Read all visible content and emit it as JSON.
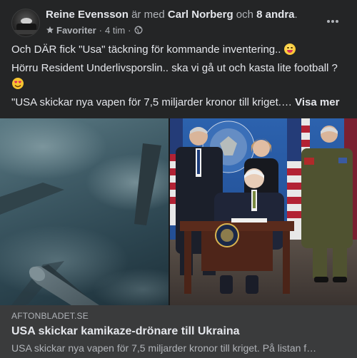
{
  "post": {
    "author": "Reine Evensson",
    "connector": "är med",
    "tagged_person": "Carl Norberg",
    "and": "och",
    "others": "8 andra",
    "period": ".",
    "audience": "Favoriter",
    "dot": "·",
    "time": "4 tim",
    "line1": "Och DÄR fick \"Usa\" täckning för kommande inventering..",
    "line2": "Hörru Resident Underlivsporslin.. ska vi gå ut och kasta lite football ?",
    "line3": "\"USA skickar nya vapen för 7,5 miljarder kronor till kriget.…",
    "see_more": "Visa mer",
    "icons": {
      "audience": "star-icon",
      "privacy": "globe-icon",
      "menu": "more-options-icon",
      "emoji1": "grinning-emoji-icon",
      "emoji2": "heart-eyes-emoji-icon"
    }
  },
  "media": {
    "left_image": "drone-in-clouds",
    "right_image": "president-signing-at-desk"
  },
  "link_preview": {
    "domain": "AFTONBLADET.SE",
    "title": "USA skickar kamikaze-drönare till Ukraina",
    "description": "USA skickar nya vapen för 7,5 miljarder kronor till kriget. På listan f…"
  },
  "colors": {
    "background": "#242526",
    "text_primary": "#e4e6eb",
    "text_secondary": "#b0b3b8",
    "link_preview_bg": "#3a3b3c"
  }
}
